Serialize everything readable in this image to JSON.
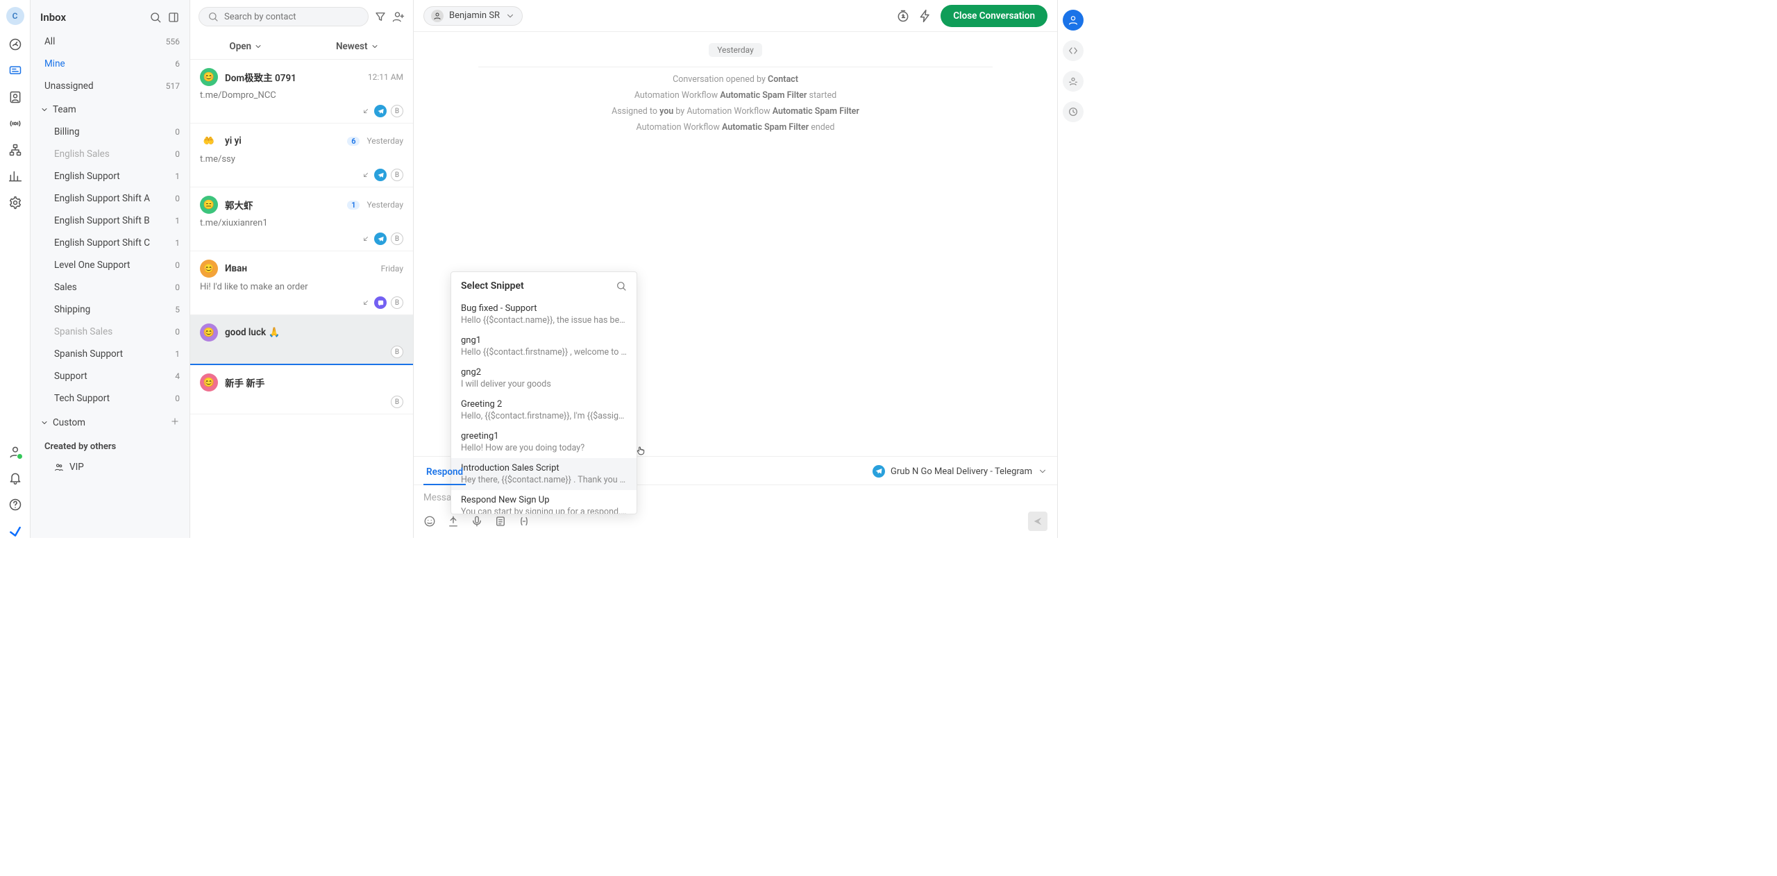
{
  "nav_rail": {
    "avatar_initial": "C"
  },
  "sidebar": {
    "title": "Inbox",
    "filters": [
      {
        "label": "All",
        "count": "556",
        "active": false
      },
      {
        "label": "Mine",
        "count": "6",
        "active": true
      },
      {
        "label": "Unassigned",
        "count": "517",
        "active": false
      }
    ],
    "team_label": "Team",
    "teams": [
      {
        "label": "Billing",
        "count": "0"
      },
      {
        "label": "English Sales",
        "count": "0",
        "muted": true
      },
      {
        "label": "English Support",
        "count": "1"
      },
      {
        "label": "English Support Shift A",
        "count": "0"
      },
      {
        "label": "English Support Shift B",
        "count": "1"
      },
      {
        "label": "English Support Shift C",
        "count": "1"
      },
      {
        "label": "Level One Support",
        "count": "0"
      },
      {
        "label": "Sales",
        "count": "0"
      },
      {
        "label": "Shipping",
        "count": "5"
      },
      {
        "label": "Spanish Sales",
        "count": "0",
        "muted": true
      },
      {
        "label": "Spanish Support",
        "count": "1"
      },
      {
        "label": "Support",
        "count": "4"
      },
      {
        "label": "Tech Support",
        "count": "0"
      }
    ],
    "custom_label": "Custom",
    "created_by_others_label": "Created by others",
    "custom_items": [
      {
        "label": "VIP"
      }
    ]
  },
  "convlist": {
    "search_placeholder": "Search by contact",
    "tab_open": "Open",
    "tab_sort": "Newest",
    "items": [
      {
        "av_bg": "#3cc47c",
        "av_txt": "😊",
        "name": "Dom极致主 0791",
        "time": "12:11 AM",
        "preview": "t.me/Dompro_NCC",
        "channel": "telegram",
        "agent": "B"
      },
      {
        "av_bg": "#fff",
        "av_txt": "🤲",
        "name": "yi yi",
        "badge": "6",
        "time": "Yesterday",
        "preview": "t.me/ssy",
        "channel": "telegram",
        "agent": "B"
      },
      {
        "av_bg": "#3cc47c",
        "av_txt": "😑",
        "name": "郭大虾",
        "badge": "1",
        "time": "Yesterday",
        "preview": "t.me/xiuxianren1",
        "channel": "telegram",
        "agent": "B"
      },
      {
        "av_bg": "#f3a33a",
        "av_txt": "😊",
        "name": "Иван",
        "time": "Friday",
        "preview": "Hi! I'd like to make an order",
        "channel": "viber",
        "agent": "B"
      },
      {
        "av_bg": "#b07fe0",
        "av_txt": "😊",
        "name": "good luck 🙏",
        "time": "",
        "preview": "",
        "channel": "",
        "agent": "B",
        "selected": true
      },
      {
        "av_bg": "#ef6f8f",
        "av_txt": "😊",
        "name": "新手 新手",
        "time": "",
        "preview": "",
        "channel": "",
        "agent": "B"
      }
    ]
  },
  "main": {
    "assignee": "Benjamin SR",
    "close_label": "Close Conversation",
    "day_label": "Yesterday",
    "opened_prefix": "Conversation opened by ",
    "opened_actor": "Contact",
    "wf_started_prefix": "Automation Workflow ",
    "wf_name": "Automatic Spam Filter",
    "wf_started_suffix": " started",
    "assigned_prefix": "Assigned to ",
    "assigned_you": "you",
    "assigned_mid": " by Automation Workflow ",
    "wf_ended_suffix": " ended"
  },
  "snippet": {
    "title": "Select Snippet",
    "items": [
      {
        "t": "Bug fixed - Support",
        "p": "Hello {{$contact.name}}, the issue has been solved. …"
      },
      {
        "t": "gng1",
        "p": "Hello {{$contact.firstname}} , welcome to Grub N Go!"
      },
      {
        "t": "gng2",
        "p": "I will deliver your goods"
      },
      {
        "t": "Greeting 2",
        "p": "Hello, {{$contact.firstname}}, I'm {{$assignee.firstna…"
      },
      {
        "t": "greeting1",
        "p": "Hello! How are you doing today?"
      },
      {
        "t": "Introduction Sales Script",
        "p": "Hey there, {{$contact.name}} . Thank you for followin…",
        "hov": true
      },
      {
        "t": "Respond New Sign Up",
        "p": "You can start by signing up for a respond.io account …"
      }
    ]
  },
  "composer": {
    "tab_respond": "Respond",
    "channel_name": "Grub N Go Meal Delivery - Telegram",
    "placeholder": "Message"
  }
}
